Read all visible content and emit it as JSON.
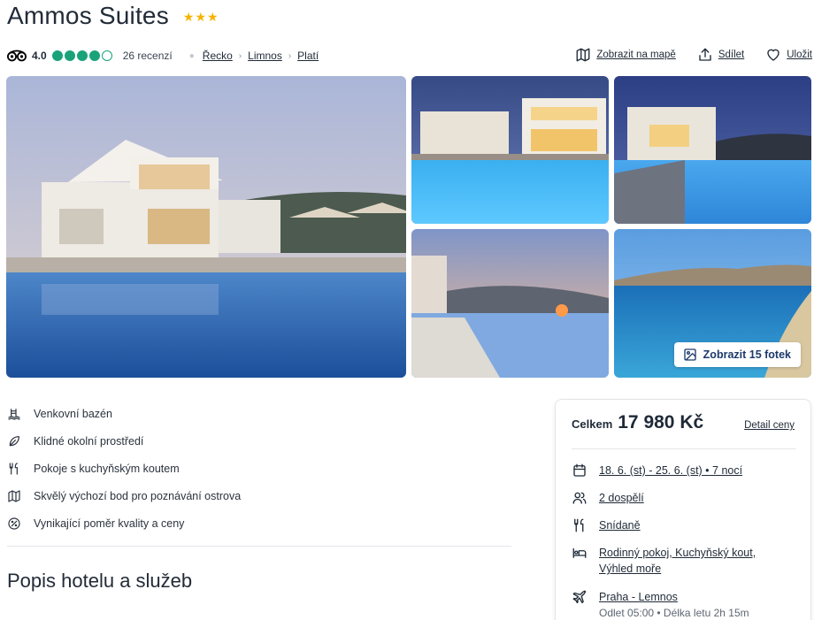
{
  "hotel": {
    "name": "Ammos Suites",
    "stars": "★★★"
  },
  "rating": {
    "score": "4.0",
    "bubbles_filled": 4,
    "bubbles_total": 5,
    "reviews": "26 recenzí"
  },
  "breadcrumb": [
    "Řecko",
    "Limnos",
    "Platí"
  ],
  "actions": {
    "map": "Zobrazit na mapě",
    "share": "Sdílet",
    "save": "Uložit"
  },
  "gallery": {
    "show_photos_label": "Zobrazit 15 fotek"
  },
  "amenities": [
    {
      "icon": "pool-icon",
      "label": "Venkovní bazén"
    },
    {
      "icon": "leaf-icon",
      "label": "Klidné okolní prostředí"
    },
    {
      "icon": "cutlery-icon",
      "label": "Pokoje s kuchyňským koutem"
    },
    {
      "icon": "map-icon",
      "label": "Skvělý výchozí bod pro poznávání ostrova"
    },
    {
      "icon": "discount-icon",
      "label": "Vynikající poměr kvality a ceny"
    }
  ],
  "description": {
    "title": "Popis hotelu a služeb"
  },
  "price_box": {
    "total_label": "Celkem",
    "total_value": "17 980 Kč",
    "detail_link": "Detail ceny",
    "dates": "18. 6. (st) - 25. 6. (st) • 7 nocí",
    "guests": "2 dospělí",
    "board": "Snídaně",
    "room_line1": "Rodinný pokoj, Kuchyňský kout,",
    "room_line2": "Výhled moře",
    "flight": "Praha - Lemnos",
    "flight_detail": "Odlet 05:00 • Délka letu 2h 15m"
  },
  "colors": {
    "star": "#f5b400",
    "rating_green": "#1aa37a",
    "link_blue": "#1d3a6b"
  }
}
